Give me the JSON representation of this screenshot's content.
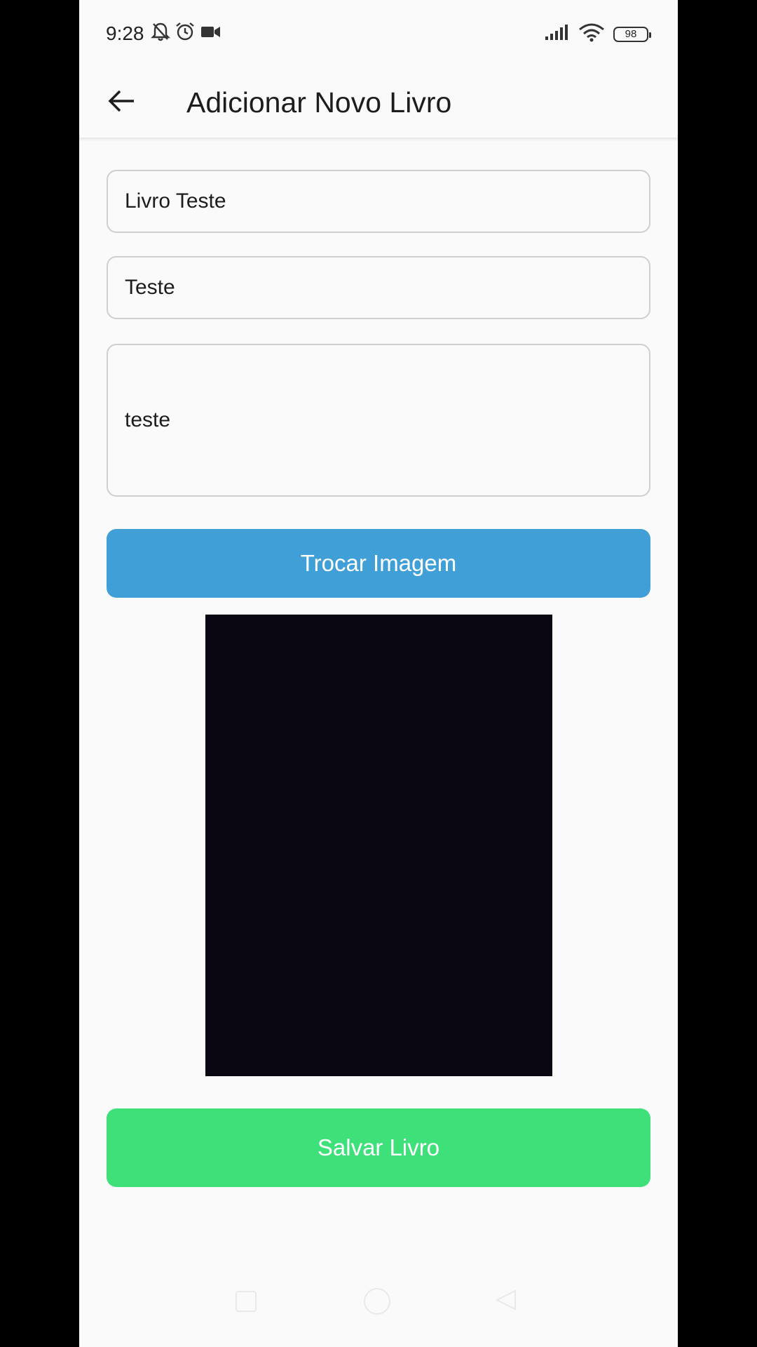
{
  "status_bar": {
    "time": "9:28",
    "battery": "98",
    "left_icons": [
      "bell-off-icon",
      "alarm-icon",
      "video-camera-icon"
    ],
    "right_icons": [
      "signal-icon",
      "wifi-icon",
      "battery-icon"
    ]
  },
  "app_bar": {
    "back_icon": "arrow-left-icon",
    "title": "Adicionar Novo Livro"
  },
  "form": {
    "title_value": "Livro Teste",
    "author_value": "Teste",
    "description_value": "teste",
    "change_image_label": "Trocar Imagem",
    "save_label": "Salvar Livro"
  },
  "colors": {
    "change_image_button": "#3f9fd6",
    "save_button": "#3ee07a",
    "image_preview": "#0b0712"
  },
  "nav_bar": {
    "icons": [
      "recents-square-icon",
      "home-circle-icon",
      "back-triangle-icon"
    ]
  }
}
